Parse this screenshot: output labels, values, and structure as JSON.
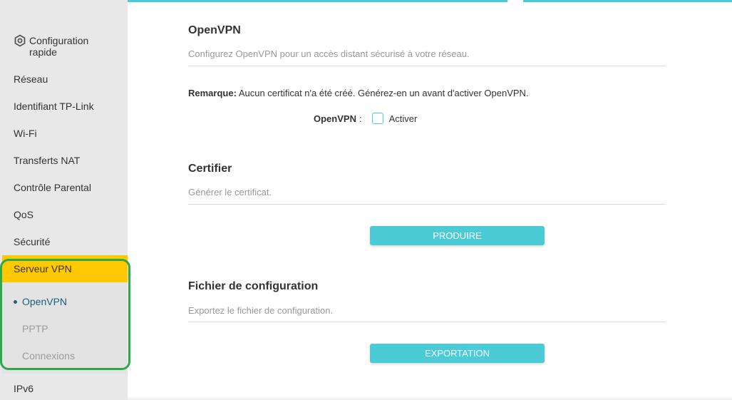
{
  "sidebar": {
    "config_label": "Configuration rapide",
    "items": [
      {
        "label": "Réseau"
      },
      {
        "label": "Identifiant TP-Link"
      },
      {
        "label": "Wi-Fi"
      },
      {
        "label": "Transferts NAT"
      },
      {
        "label": "Contrôle Parental"
      },
      {
        "label": "QoS"
      },
      {
        "label": "Sécurité"
      }
    ],
    "active_item": "Serveur VPN",
    "sub_items": [
      {
        "label": "OpenVPN",
        "active": true
      },
      {
        "label": "PPTP",
        "active": false
      },
      {
        "label": "Connexions",
        "active": false
      }
    ],
    "after_item": "IPv6"
  },
  "openvpn": {
    "title": "OpenVPN",
    "description": "Configurez OpenVPN pour un accès distant sécurisé à votre réseau.",
    "remark_label": "Remarque:",
    "remark_text": " Aucun certificat n'a été créé. Générez-en un avant d'activer OpenVPN.",
    "toggle_label": "OpenVPN",
    "toggle_colon": ":",
    "checkbox_label": "Activer",
    "checked": false
  },
  "certifier": {
    "title": "Certifier",
    "description": "Générer le certificat.",
    "button_label": "PRODUIRE"
  },
  "config_file": {
    "title": "Fichier de configuration",
    "description": "Exportez le fichier de configuration.",
    "button_label": "EXPORTATION"
  },
  "colors": {
    "accent": "#4acbd6",
    "active_menu": "#ffc800",
    "highlight_outline": "#2fa84a",
    "sub_active": "#1c5f7a"
  }
}
